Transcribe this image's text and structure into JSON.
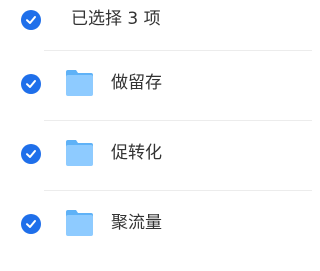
{
  "header": {
    "selected_label": "已选择 3 项",
    "check_icon": "checkmark-circle-icon"
  },
  "colors": {
    "accent": "#1f6fea",
    "folder_body": "#8ecbff",
    "folder_tab": "#5fb2f7",
    "divider": "#ececec",
    "text": "#333333"
  },
  "items": [
    {
      "label": "做留存",
      "icon": "folder-icon",
      "selected": true
    },
    {
      "label": "促转化",
      "icon": "folder-icon",
      "selected": true
    },
    {
      "label": "聚流量",
      "icon": "folder-icon",
      "selected": true
    }
  ]
}
